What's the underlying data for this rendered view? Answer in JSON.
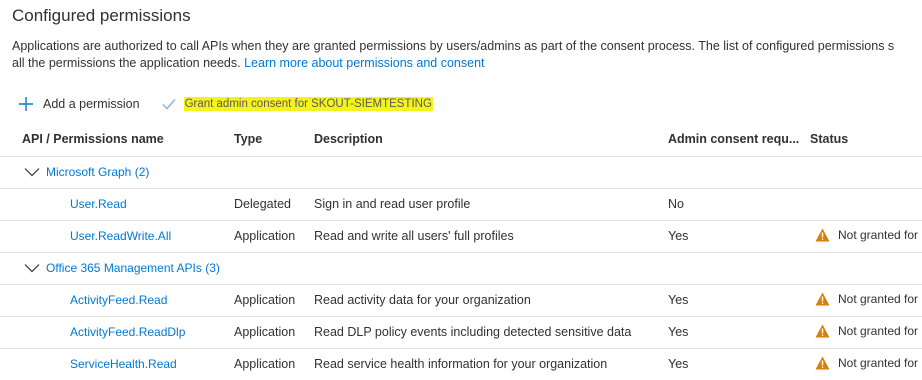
{
  "page": {
    "title": "Configured permissions",
    "description_line1": "Applications are authorized to call APIs when they are granted permissions by users/admins as part of the consent process. The list of configured permissions s",
    "description_line2": "all the permissions the application needs. ",
    "learn_more_link": "Learn more about permissions and consent"
  },
  "toolbar": {
    "add_permission_label": "Add a permission",
    "grant_consent_label": "Grant admin consent for SKOUT-SIEMTESTING",
    "add_icon": "plus-icon",
    "grant_icon": "checkmark-icon"
  },
  "table": {
    "headers": {
      "api": "API / Permissions name",
      "type": "Type",
      "description": "Description",
      "admin_consent": "Admin consent requ...",
      "status": "Status"
    },
    "groups": [
      {
        "name": "Microsoft Graph (2)",
        "rows": [
          {
            "name": "User.Read",
            "type": "Delegated",
            "description": "Sign in and read user profile",
            "admin_consent": "No",
            "status": ""
          },
          {
            "name": "User.ReadWrite.All",
            "type": "Application",
            "description": "Read and write all users' full profiles",
            "admin_consent": "Yes",
            "status": "Not granted for"
          }
        ]
      },
      {
        "name": "Office 365 Management APIs (3)",
        "rows": [
          {
            "name": "ActivityFeed.Read",
            "type": "Application",
            "description": "Read activity data for your organization",
            "admin_consent": "Yes",
            "status": "Not granted for"
          },
          {
            "name": "ActivityFeed.ReadDlp",
            "type": "Application",
            "description": "Read DLP policy events including detected sensitive data",
            "admin_consent": "Yes",
            "status": "Not granted for"
          },
          {
            "name": "ServiceHealth.Read",
            "type": "Application",
            "description": "Read service health information for your organization",
            "admin_consent": "Yes",
            "status": "Not granted for"
          }
        ]
      }
    ]
  },
  "colors": {
    "link": "#0078d4",
    "highlight": "#f4f41c",
    "warning": "#d67f0e",
    "border": "#e1dfdd",
    "text": "#323130"
  }
}
